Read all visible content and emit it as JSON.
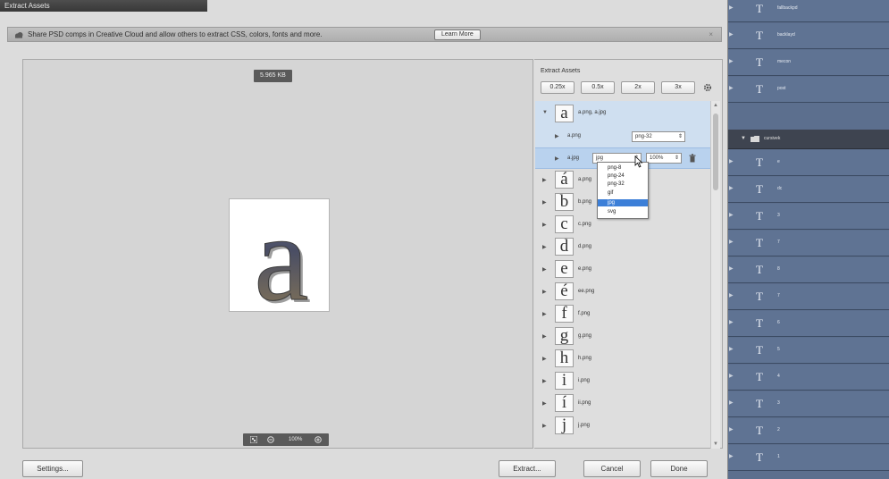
{
  "window": {
    "title": "Extract Assets"
  },
  "notice": {
    "text": "Share PSD comps in Creative Cloud and allow others to extract CSS, colors, fonts and more.",
    "learn_more": "Learn More",
    "close": "×"
  },
  "preview": {
    "file_size": "5.965 KB",
    "asset_glyph": "a",
    "zoom": "100%"
  },
  "panel": {
    "title": "Extract Assets",
    "scales": [
      "0.25x",
      "0.5x",
      "2x",
      "3x"
    ],
    "top_asset": {
      "glyph": "a",
      "label": "a.png, a.jpg"
    },
    "sub1": {
      "label": "a.png",
      "format": "png-32"
    },
    "sub2": {
      "label": "a.jpg",
      "format": "jpg",
      "quality": "100%"
    },
    "format_options": [
      "png-8",
      "png-24",
      "png-32",
      "gif",
      "jpg",
      "svg"
    ],
    "selected_format": "jpg",
    "assets": [
      {
        "glyph": "á",
        "label": "a.png"
      },
      {
        "glyph": "b",
        "label": "b.png"
      },
      {
        "glyph": "c",
        "label": "c.png"
      },
      {
        "glyph": "d",
        "label": "d.png"
      },
      {
        "glyph": "e",
        "label": "e.png"
      },
      {
        "glyph": "é",
        "label": "ee.png"
      },
      {
        "glyph": "f",
        "label": "f.png"
      },
      {
        "glyph": "g",
        "label": "g.png"
      },
      {
        "glyph": "h",
        "label": "h.png"
      },
      {
        "glyph": "i",
        "label": "i.png"
      },
      {
        "glyph": "í",
        "label": "ii.png"
      },
      {
        "glyph": "j",
        "label": "j.png"
      }
    ]
  },
  "buttons": {
    "settings": "Settings...",
    "extract": "Extract...",
    "cancel": "Cancel",
    "done": "Done"
  },
  "layers": {
    "type_glyph": "T",
    "items_top": [
      "fallbackpd",
      "backlayd",
      "mecon",
      "post"
    ],
    "group": "cursivek",
    "items_bottom": [
      "e",
      "dc",
      "3",
      "7",
      "8",
      "7",
      "6",
      "5",
      "4",
      "3",
      "2",
      "1"
    ]
  },
  "colors": {
    "selection": "#3c7fd8",
    "layers_bg": "#5f7393",
    "row_highlight": "#cfdff0"
  }
}
